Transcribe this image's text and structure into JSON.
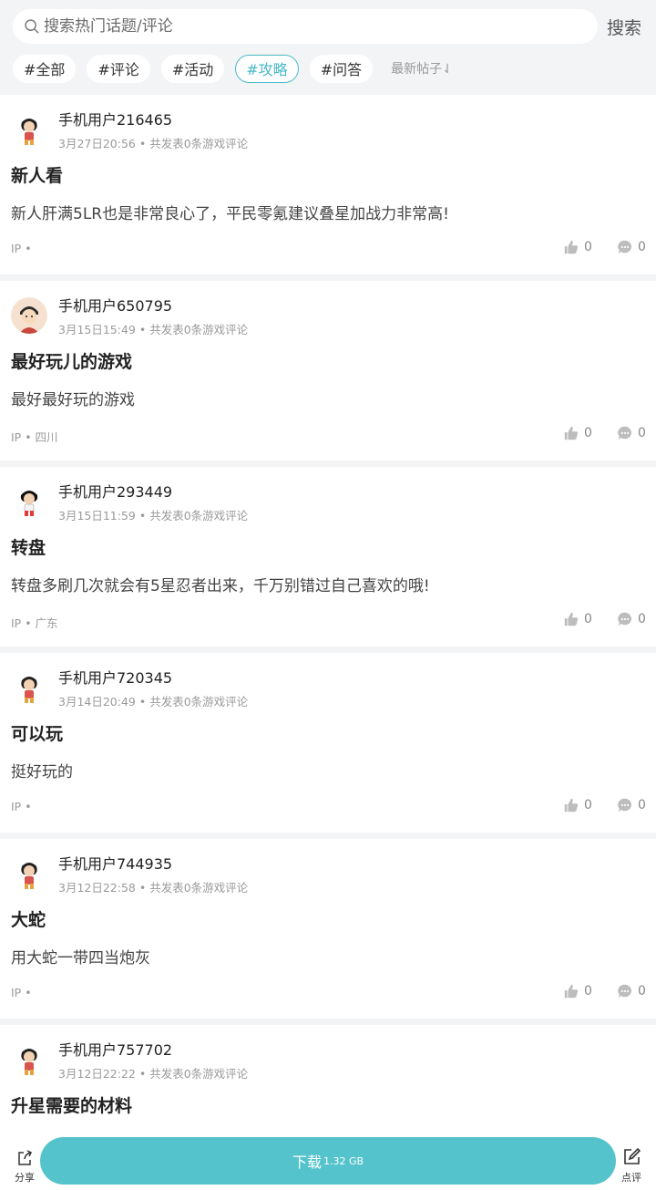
{
  "search": {
    "placeholder": "搜索热门话题/评论",
    "button_label": "搜索"
  },
  "tags": [
    {
      "label": "#全部",
      "active": false
    },
    {
      "label": "#评论",
      "active": false
    },
    {
      "label": "#活动",
      "active": false
    },
    {
      "label": "#攻略",
      "active": true
    },
    {
      "label": "#问答",
      "active": false
    }
  ],
  "sort_label": "最新帖子⇃",
  "posts": [
    {
      "user": "手机用户216465",
      "time": "3月27日20:56",
      "stats": " • 共发表0条游戏评论",
      "title": "新人看",
      "content": "新人肝满5LR也是非常良心了，平民零氪建议叠星加战力非常高!",
      "ip": "IP • ",
      "likes": "0",
      "comments": "0",
      "avatar": "cartoon-boy-icon"
    },
    {
      "user": "手机用户650795",
      "time": "3月15日15:49",
      "stats": " • 共发表0条游戏评论",
      "title": "最好玩儿的游戏",
      "content": "最好最好玩的游戏",
      "ip": "IP • 四川",
      "likes": "0",
      "comments": "0",
      "avatar": "cartoon-face-icon"
    },
    {
      "user": "手机用户293449",
      "time": "3月15日11:59",
      "stats": " • 共发表0条游戏评论",
      "title": "转盘",
      "content": "转盘多刷几次就会有5星忍者出来，千万别错过自己喜欢的哦!",
      "ip": "IP • 广东",
      "likes": "0",
      "comments": "0",
      "avatar": "cartoon-boy-icon"
    },
    {
      "user": "手机用户720345",
      "time": "3月14日20:49",
      "stats": " • 共发表0条游戏评论",
      "title": "可以玩",
      "content": "挺好玩的",
      "ip": "IP • ",
      "likes": "0",
      "comments": "0",
      "avatar": "cartoon-boy-icon"
    },
    {
      "user": "手机用户744935",
      "time": "3月12日22:58",
      "stats": " • 共发表0条游戏评论",
      "title": "大蛇",
      "content": "用大蛇一带四当炮灰",
      "ip": "IP • ",
      "likes": "0",
      "comments": "0",
      "avatar": "cartoon-boy-icon"
    },
    {
      "user": "手机用户757702",
      "time": "3月12日22:22",
      "stats": " • 共发表0条游戏评论",
      "title": "升星需要的材料",
      "content": "",
      "ip": "",
      "likes": "",
      "comments": "",
      "avatar": "cartoon-boy-icon"
    }
  ],
  "bottom": {
    "share_label": "分享",
    "download_label": "下载",
    "download_size": "1.32 GB",
    "review_label": "点评"
  },
  "colors": {
    "accent": "#4bb8c8",
    "download_bg": "#55c3cb",
    "page_bg": "#f3f4f6"
  }
}
